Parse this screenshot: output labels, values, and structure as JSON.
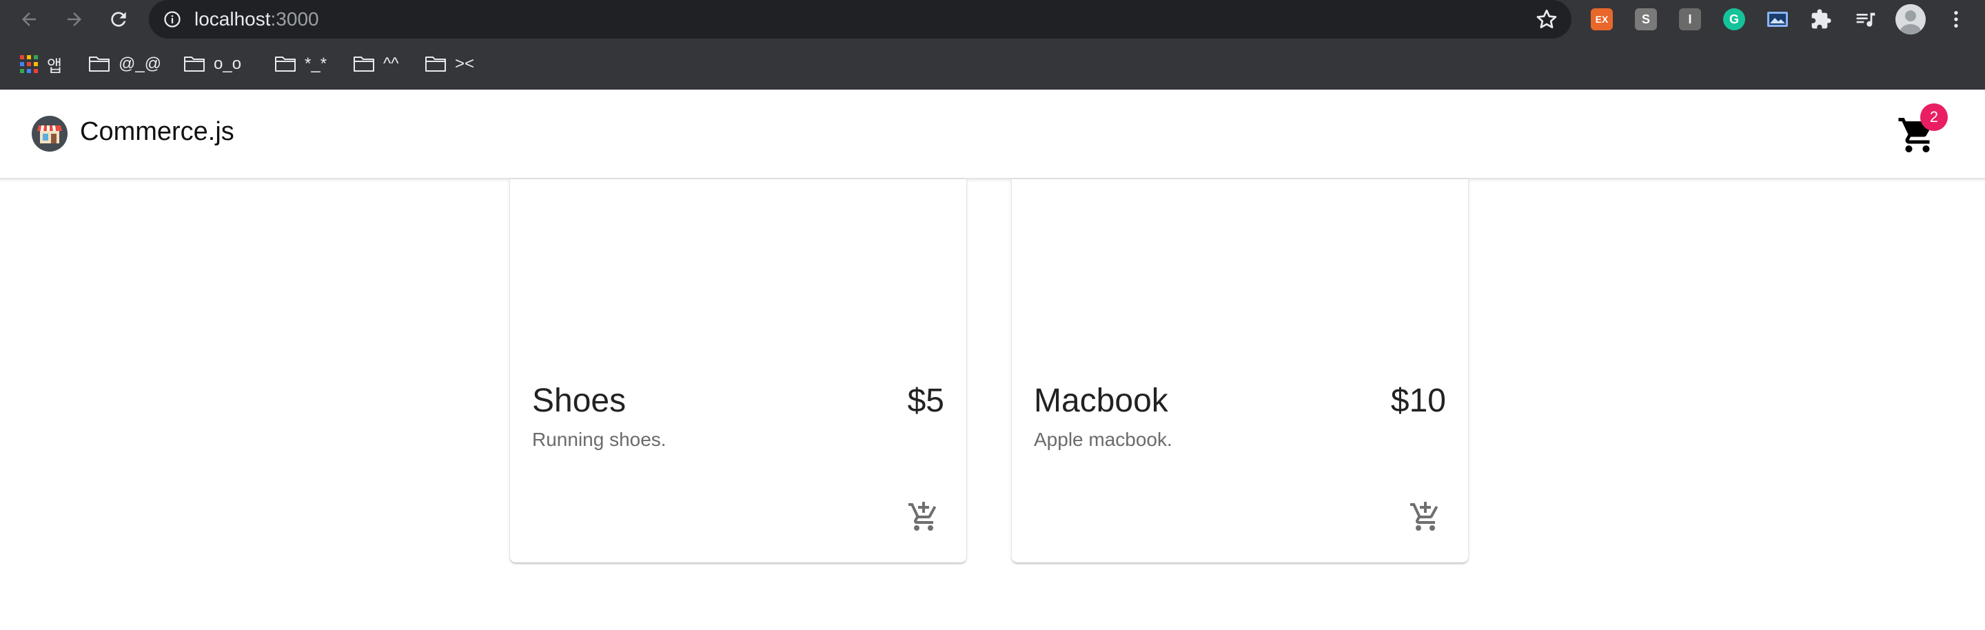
{
  "browser": {
    "url_host": "localhost",
    "url_port": ":3000",
    "extensions": [
      {
        "name": "ex-extension",
        "label": "EX",
        "color": "#e8672a"
      },
      {
        "name": "s-extension",
        "label": "S",
        "color": "#7a7a7a"
      },
      {
        "name": "i-extension",
        "label": "I",
        "color": "#6a6a6a"
      },
      {
        "name": "grammarly-extension",
        "label": "G",
        "color": "#15c39a"
      }
    ],
    "bookmarks": [
      {
        "label": "앱",
        "icon": "apps-grid-icon"
      },
      {
        "label": "@_@",
        "icon": "folder-icon"
      },
      {
        "label": "o_o",
        "icon": "folder-icon"
      },
      {
        "label": "*_*",
        "icon": "folder-icon"
      },
      {
        "label": "^^",
        "icon": "folder-icon"
      },
      {
        "label": "><",
        "icon": "folder-icon"
      }
    ]
  },
  "app": {
    "brand": "Commerce.js",
    "cart_count": "2",
    "accent_color": "#e91e63"
  },
  "products": [
    {
      "name": "Shoes",
      "price": "$5",
      "description": "Running shoes."
    },
    {
      "name": "Macbook",
      "price": "$10",
      "description": "Apple macbook."
    }
  ]
}
